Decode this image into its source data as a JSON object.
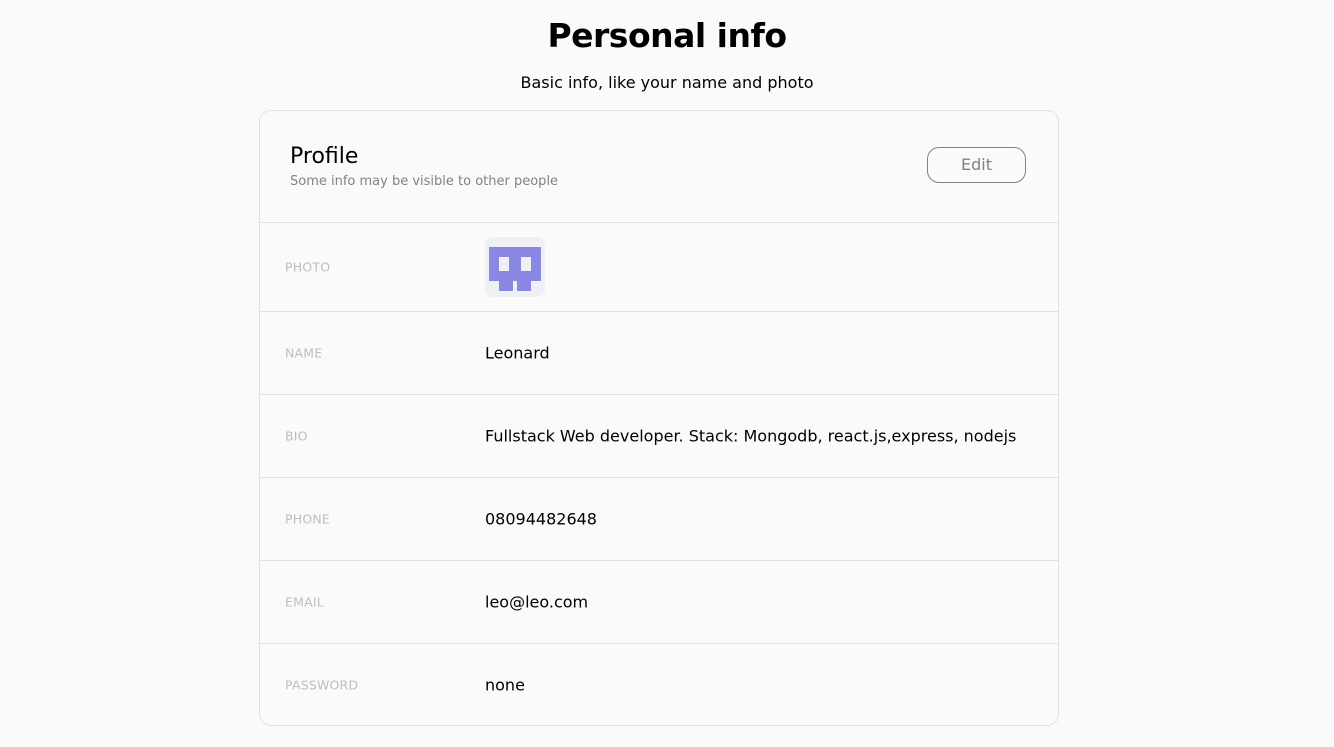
{
  "page": {
    "title": "Personal info",
    "subtitle": "Basic info, like your name and photo"
  },
  "profile": {
    "title": "Profile",
    "subtitle": "Some info may be visible to other people",
    "edit_label": "Edit"
  },
  "rows": {
    "photo": {
      "label": "PHOTO",
      "avatar_color": "#8b88e3"
    },
    "name": {
      "label": "NAME",
      "value": "Leonard"
    },
    "bio": {
      "label": "BIO",
      "value": "Fullstack Web developer. Stack: Mongodb, react.js,express, nodejs"
    },
    "phone": {
      "label": "PHONE",
      "value": "08094482648"
    },
    "email": {
      "label": "EMAIL",
      "value": "leo@leo.com"
    },
    "password": {
      "label": "PASSWORD",
      "value": "none"
    }
  },
  "colors": {
    "background": "#fafafa",
    "border": "#e0e0e0",
    "muted_text": "#828282",
    "label_text": "#bdbdbd"
  }
}
